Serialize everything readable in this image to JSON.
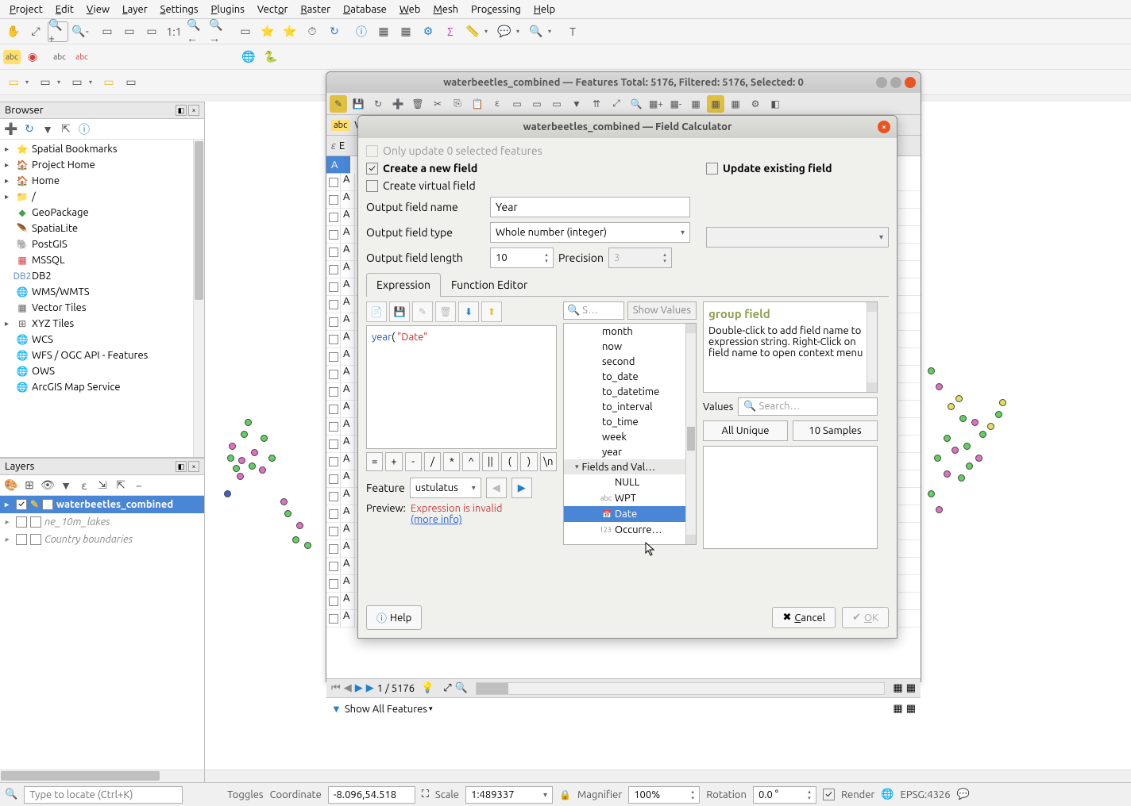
{
  "menubar": [
    "Project",
    "Edit",
    "View",
    "Layer",
    "Settings",
    "Plugins",
    "Vector",
    "Raster",
    "Database",
    "Web",
    "Mesh",
    "Processing",
    "Help"
  ],
  "browser": {
    "title": "Browser",
    "items": [
      {
        "icon": "⭐",
        "label": "Spatial Bookmarks",
        "expandable": true
      },
      {
        "icon": "🏠",
        "label": "Project Home",
        "expandable": true,
        "iconcolor": "#48a048"
      },
      {
        "icon": "🏠",
        "label": "Home",
        "expandable": true
      },
      {
        "icon": "📁",
        "label": "/",
        "expandable": true
      },
      {
        "icon": "◆",
        "label": "GeoPackage",
        "iconcolor": "#48a048"
      },
      {
        "icon": "🪶",
        "label": "SpatiaLite",
        "iconcolor": "#5080c0"
      },
      {
        "icon": "🐘",
        "label": "PostGIS",
        "iconcolor": "#5080c0"
      },
      {
        "icon": "▦",
        "label": "MSSQL",
        "iconcolor": "#d04040"
      },
      {
        "icon": "DB2",
        "label": "DB2",
        "iconcolor": "#5080c0"
      },
      {
        "icon": "🌐",
        "label": "WMS/WMTS",
        "iconcolor": "#5080c0"
      },
      {
        "icon": "▦",
        "label": "Vector Tiles"
      },
      {
        "icon": "⊞",
        "label": "XYZ Tiles",
        "expandable": true
      },
      {
        "icon": "🌐",
        "label": "WCS",
        "iconcolor": "#5080c0"
      },
      {
        "icon": "🌐",
        "label": "WFS / OGC API - Features",
        "iconcolor": "#5080c0"
      },
      {
        "icon": "🌐",
        "label": "OWS",
        "iconcolor": "#5080c0"
      },
      {
        "icon": "🌐",
        "label": "ArcGIS Map Service",
        "iconcolor": "#5080c0"
      }
    ]
  },
  "layers": {
    "title": "Layers",
    "items": [
      {
        "checked": true,
        "label": "waterbeetles_combined",
        "selected": true,
        "pencil": true
      },
      {
        "checked": false,
        "label": "ne_10m_lakes",
        "italic": true
      },
      {
        "checked": false,
        "label": "Country boundaries",
        "italic": true
      }
    ]
  },
  "attr_table": {
    "title": "waterbeetles_combined — Features Total: 5176, Filtered: 5176, Selected: 0",
    "nav": "1 / 5176",
    "footer": "Show All Features"
  },
  "field_calc": {
    "title": "waterbeetles_combined — Field Calculator",
    "only_update": "Only update 0 selected features",
    "create_new": "Create a new field",
    "update_existing": "Update existing field",
    "create_virtual": "Create virtual field",
    "out_name_label": "Output field name",
    "out_name": "Year",
    "out_type_label": "Output field type",
    "out_type": "Whole number (integer)",
    "out_len_label": "Output field length",
    "out_len": "10",
    "precision_label": "Precision",
    "precision": "3",
    "tabs": {
      "expression": "Expression",
      "function_editor": "Function Editor"
    },
    "expression_text": {
      "fn": "year",
      "open": "(   ",
      "str": "\"Date\""
    },
    "func_search_placeholder": "S…",
    "show_values": "Show Values",
    "functions": [
      "month",
      "now",
      "second",
      "to_date",
      "to_datetime",
      "to_interval",
      "to_time",
      "week",
      "year"
    ],
    "fields_group": "Fields and Val…",
    "fields": [
      {
        "type": "",
        "name": "NULL"
      },
      {
        "type": "abc",
        "name": "WPT"
      },
      {
        "type": "📅",
        "name": "Date",
        "selected": true
      },
      {
        "type": "123",
        "name": "Occurre…"
      }
    ],
    "help_title": "group field",
    "help_body": "Double-click to add field name to expression string. Right-Click on field name to open context menu",
    "values_label": "Values",
    "values_search_placeholder": "Search…",
    "all_unique": "All Unique",
    "ten_samples": "10 Samples",
    "feature_label": "Feature",
    "feature_value": "ustulatus",
    "preview_label": "Preview:",
    "preview_error": "Expression is invalid",
    "preview_link": "(more info)",
    "help_btn": "Help",
    "cancel_btn": "Cancel",
    "ok_btn": "OK",
    "ops": [
      "=",
      "+",
      "-",
      "/",
      "*",
      "^",
      "||",
      "(",
      ")",
      "\\n"
    ]
  },
  "statusbar": {
    "locator_placeholder": "Type to locate (Ctrl+K)",
    "toggles": "Toggles",
    "coord_label": "Coordinate",
    "coord": "-8.096,54.518",
    "scale_label": "Scale",
    "scale": "1:489337",
    "mag_label": "Magnifier",
    "mag": "100%",
    "rot_label": "Rotation",
    "rot": "0.0 °",
    "render": "Render",
    "crs": "EPSG:4326"
  }
}
